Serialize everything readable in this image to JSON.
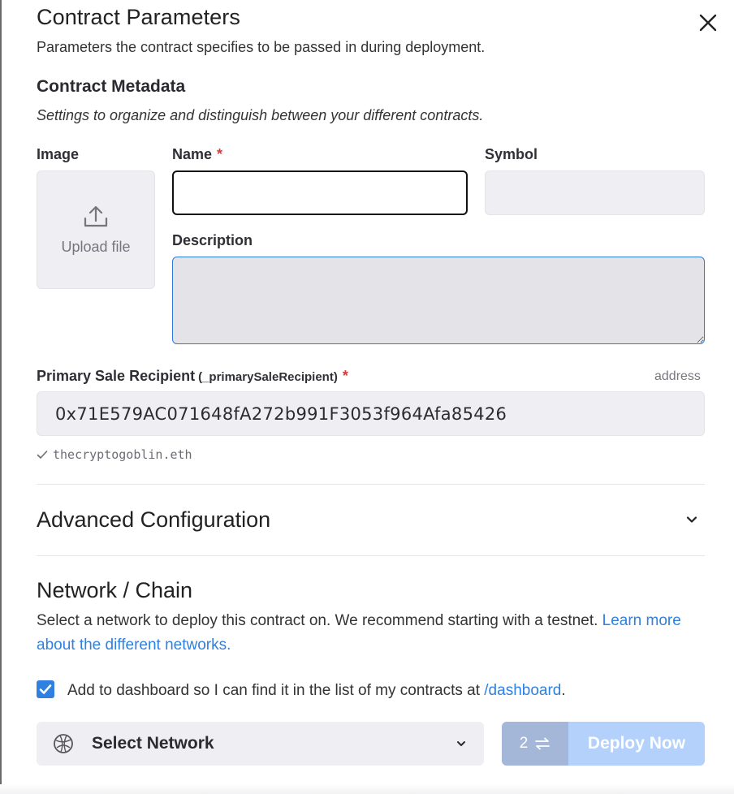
{
  "header": {
    "title": "Contract Parameters",
    "subtitle": "Parameters the contract specifies to be passed in during deployment."
  },
  "metadata": {
    "heading": "Contract Metadata",
    "description": "Settings to organize and distinguish between your different contracts.",
    "image_label": "Image",
    "upload_label": "Upload file",
    "name_label": "Name",
    "name_value": "",
    "symbol_label": "Symbol",
    "symbol_value": "",
    "description_label": "Description",
    "description_value": "",
    "required_marker": "*"
  },
  "recipient": {
    "label": "Primary Sale Recipient",
    "param": "(_primarySaleRecipient)",
    "required_marker": "*",
    "type": "address",
    "value": "0x71E579AC071648fA272b991F3053f964Afa85426",
    "ens": "thecryptogoblin.eth"
  },
  "advanced": {
    "title": "Advanced Configuration"
  },
  "network": {
    "title": "Network / Chain",
    "description": "Select a network to deploy this contract on. We recommend starting with a testnet. ",
    "link": "Learn more about the different networks.",
    "checkbox_checked": true,
    "checkbox_text": "Add to dashboard so I can find it in the list of my contracts at ",
    "checkbox_link": "/dashboard",
    "checkbox_suffix": ".",
    "select_label": "Select Network",
    "tx_count": "2",
    "deploy_label": "Deploy Now"
  },
  "colors": {
    "accent": "#2f80e0",
    "required": "#d63b3b",
    "deploy_disabled": "#b3d1fb"
  },
  "icons": {
    "close": "close-icon",
    "upload": "upload-icon",
    "check": "check-icon",
    "chevron": "chevron-down-icon",
    "network": "network-globe-icon",
    "swap": "swap-arrows-icon"
  }
}
